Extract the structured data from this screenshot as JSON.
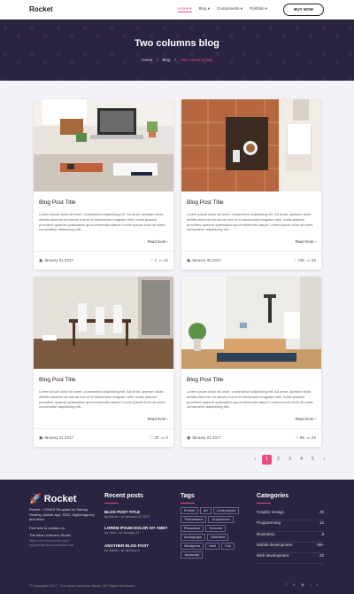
{
  "nav": {
    "logo": "Rocket",
    "menu": [
      "Home ▾",
      "Blog ▾",
      "Components ▾",
      "Portfolio ▾"
    ],
    "buy": "BUY NOW"
  },
  "hero": {
    "title": "Two columns blog",
    "crumbs": [
      "Home",
      "Blog",
      "Two columns blog"
    ]
  },
  "posts": [
    {
      "title": "Blog Post Title",
      "excerpt": "Lorem ipsum dolor sit amet, consectetur adipisicing elit. Ad amet, aperiam dicta debitis dolorem ea earum eos et id laboriosam magnam nihil, nobis placeat provident quaerat quibusdam quod reiciendis saepe! Lorem ipsum dolor sit amet, consectetur adipisicing elit...",
      "more": "Read more",
      "date": "January 01.2017",
      "likes": "2",
      "comments": "12"
    },
    {
      "title": "Blog Post Title",
      "excerpt": "Lorem ipsum dolor sit amet, consectetur adipisicing elit. Ad amet, aperiam dicta debitis dolorem ea earum eos et id laboriosam magnam nihil, nobis placeat provident quaerat quibusdam quod reiciendis saepe! Lorem ipsum dolor sit amet, consectetur adipisicing elit...",
      "more": "Read more",
      "date": "January 05.2017",
      "likes": "235",
      "comments": "46"
    },
    {
      "title": "Blog Post Title",
      "excerpt": "Lorem ipsum dolor sit amet, consectetur adipisicing elit. Ad amet, aperiam dicta debitis dolorem ea earum eos et id laboriosam magnam nihil, nobis placeat provident quaerat quibusdam quod reiciendis saepe! Lorem ipsum dolor sit amet, consectetur adipisicing elit...",
      "more": "Read more",
      "date": "January 21.2017",
      "likes": "32",
      "comments": "0"
    },
    {
      "title": "Blog Post Title",
      "excerpt": "Lorem ipsum dolor sit amet, consectetur adipisicing elit. Ad amet, aperiam dicta debitis dolorem ea earum eos et id laboriosam magnam nihil, nobis placeat provident quaerat quibusdam quod reiciendis saepe! Lorem ipsum dolor sit amet, consectetur adipisicing elit...",
      "more": "Read more",
      "date": "January 21.2017",
      "likes": "99",
      "comments": "20"
    }
  ],
  "pagination": {
    "prev": "‹",
    "pages": [
      "1",
      "2",
      "3",
      "4",
      "5"
    ],
    "next": "›",
    "active": "1"
  },
  "footer": {
    "logo": "Rocket",
    "desc": "Rocket - HTML5 Template for Startup, Hosting, Mobile App, SEO, Digital Agency and more.",
    "contact_label": "Feel free to contact us:",
    "company": "The Neon Unicorns Studio",
    "link1": "https://neonunicorns.com",
    "link2": "support@neonunicorns.com",
    "recent_head": "Recent posts",
    "recent": [
      {
        "title": "BLOG POST TITLE",
        "meta": "by Admin / at January 01.2017"
      },
      {
        "title": "LOREM IPSUM DOLOR SIT AMET",
        "meta": "by Jhon / at January 11"
      },
      {
        "title": "ANOTHER BLOG POST",
        "meta": "by Admin / at January 4"
      }
    ],
    "tags_head": "Tags",
    "tags": [
      "Envato",
      "Art",
      "Codecanyon",
      "Themeforest",
      "Graphicriver",
      "Photodune",
      "3docean",
      "Audiojungle",
      "Videohive",
      "Wordpress",
      "Html",
      "Css",
      "Javascript"
    ],
    "cats_head": "Categories",
    "cats": [
      {
        "name": "Graphic Design",
        "count": "20"
      },
      {
        "name": "Programming",
        "count": "12"
      },
      {
        "name": "Illustration",
        "count": "8"
      },
      {
        "name": "Mobile development",
        "count": "99+"
      },
      {
        "name": "Web development",
        "count": "20"
      }
    ],
    "copyright": "© Copyright 2017 - The Neon Unicorns Studio. All Rights Reserved.",
    "social": [
      "f",
      "✈",
      "◉",
      "t",
      "◐"
    ]
  },
  "colors": {
    "accent": "#e84c7e",
    "dark": "#2b2342",
    "bg": "#f3f2f7"
  }
}
